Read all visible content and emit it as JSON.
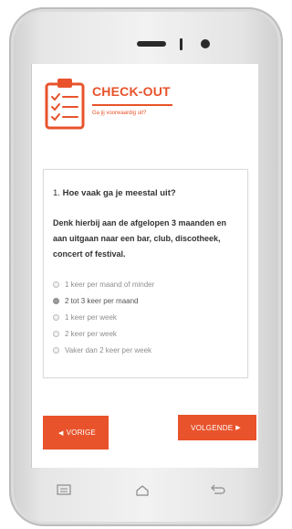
{
  "app": {
    "title": "CHECK-OUT",
    "subtitle": "Ga jij voorwaardig uit?",
    "accent_color": "#e8532b",
    "header_icon": "clipboard-checklist-icon"
  },
  "question": {
    "number": "1.",
    "text": "Hoe vaak ga je meestal uit?",
    "description": "Denk hierbij aan de afgelopen 3 maanden en aan uitgaan naar een bar, club, discotheek, concert of festival.",
    "options": [
      {
        "label": "1 keer per maand of minder",
        "selected": false
      },
      {
        "label": "2 tot 3 keer per maand",
        "selected": true
      },
      {
        "label": "1 keer per week",
        "selected": false
      },
      {
        "label": "2 keer per week",
        "selected": false
      },
      {
        "label": "Vaker dan 2 keer per week",
        "selected": false
      }
    ]
  },
  "navigation": {
    "prev_label": "VORIGE",
    "next_label": "VOLGENDE",
    "prev_icon": "triangle-left-icon",
    "next_icon": "triangle-right-icon"
  },
  "system_nav": {
    "icons": [
      "menu-icon",
      "home-icon",
      "back-icon"
    ]
  }
}
